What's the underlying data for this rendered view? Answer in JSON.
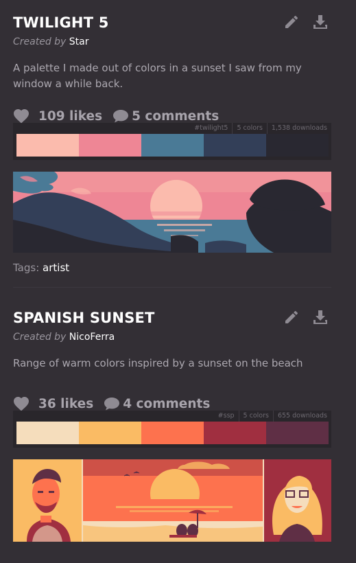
{
  "palettes": [
    {
      "title": "TWILIGHT 5",
      "created_by_label": "Created by",
      "author": "Star",
      "description": "A palette I made out of colors in a sunset I saw from my window a while back.",
      "likes": "109 likes",
      "comments": "5 comments",
      "meta": {
        "tag": "#twilight5",
        "colors": "5 colors",
        "downloads": "1,538 downloads"
      },
      "swatches": [
        "#fbbbad",
        "#ee8695",
        "#4a7a96",
        "#333f58",
        "#292831"
      ],
      "tags_label": "Tags:",
      "tag": "artist"
    },
    {
      "title": "SPANISH SUNSET",
      "created_by_label": "Created by",
      "author": "NicoFerra",
      "description": "Range of warm colors inspired by a sunset on the beach",
      "likes": "36 likes",
      "comments": "4 comments",
      "meta": {
        "tag": "#ssp",
        "colors": "5 colors",
        "downloads": "655 downloads"
      },
      "swatches": [
        "#f5ddbc",
        "#fabb64",
        "#fd724e",
        "#a02f40",
        "#5f2f45"
      ]
    }
  ],
  "icons": {
    "edit": "pencil-icon",
    "download": "download-icon",
    "like": "heart-icon",
    "comment": "speech-bubble-icon"
  },
  "colors": {
    "background": "#332f35",
    "panel": "#29262b",
    "text_primary": "#ffffff",
    "text_muted": "#aca8b0",
    "icon": "#8f8b93"
  }
}
